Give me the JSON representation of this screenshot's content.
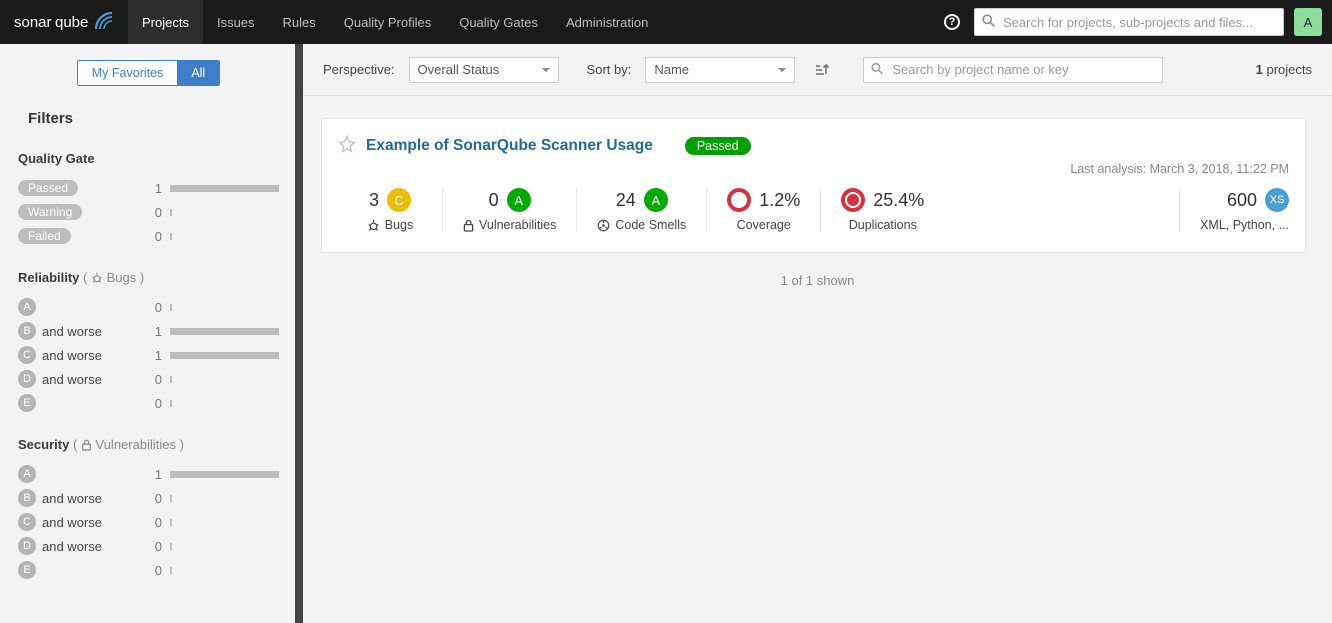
{
  "nav": {
    "items": [
      "Projects",
      "Issues",
      "Rules",
      "Quality Profiles",
      "Quality Gates",
      "Administration"
    ],
    "active": "Projects",
    "search_placeholder": "Search for projects, sub-projects and files...",
    "user_initial": "A"
  },
  "sidebar": {
    "toggles": {
      "favorites": "My Favorites",
      "all": "All"
    },
    "filters_title": "Filters",
    "facets": {
      "quality_gate": {
        "title": "Quality Gate",
        "options": [
          {
            "label": "Passed",
            "count": 1,
            "bar": 100
          },
          {
            "label": "Warning",
            "count": 0,
            "bar": 0
          },
          {
            "label": "Failed",
            "count": 0,
            "bar": 0
          }
        ]
      },
      "reliability": {
        "title": "Reliability",
        "hint": "Bugs",
        "options": [
          {
            "grade": "A",
            "label": "",
            "count": 0,
            "bar": 0
          },
          {
            "grade": "B",
            "label": "and worse",
            "count": 1,
            "bar": 100
          },
          {
            "grade": "C",
            "label": "and worse",
            "count": 1,
            "bar": 100
          },
          {
            "grade": "D",
            "label": "and worse",
            "count": 0,
            "bar": 0
          },
          {
            "grade": "E",
            "label": "",
            "count": 0,
            "bar": 0
          }
        ]
      },
      "security": {
        "title": "Security",
        "hint": "Vulnerabilities",
        "options": [
          {
            "grade": "A",
            "label": "",
            "count": 1,
            "bar": 100
          },
          {
            "grade": "B",
            "label": "and worse",
            "count": 0,
            "bar": 0
          },
          {
            "grade": "C",
            "label": "and worse",
            "count": 0,
            "bar": 0
          },
          {
            "grade": "D",
            "label": "and worse",
            "count": 0,
            "bar": 0
          },
          {
            "grade": "E",
            "label": "",
            "count": 0,
            "bar": 0
          }
        ]
      }
    }
  },
  "toolbar": {
    "perspective_label": "Perspective:",
    "perspective_value": "Overall Status",
    "sort_label": "Sort by:",
    "sort_value": "Name",
    "search_placeholder": "Search by project name or key",
    "projects_count": "1",
    "projects_word": "projects"
  },
  "project": {
    "name": "Example of SonarQube Scanner Usage",
    "quality_gate": "Passed",
    "last_analysis": "Last analysis: March 3, 2018, 11:22 PM",
    "metrics": {
      "bugs": {
        "value": "3",
        "rating": "C",
        "label": "Bugs"
      },
      "vulnerabilities": {
        "value": "0",
        "rating": "A",
        "label": "Vulnerabilities"
      },
      "code_smells": {
        "value": "24",
        "rating": "A",
        "label": "Code Smells"
      },
      "coverage": {
        "value": "1.2%",
        "label": "Coverage"
      },
      "duplications": {
        "value": "25.4%",
        "label": "Duplications"
      },
      "size": {
        "value": "600",
        "badge": "XS",
        "label": "XML, Python, ..."
      }
    }
  },
  "footer": {
    "shown": "1 of 1 shown"
  }
}
